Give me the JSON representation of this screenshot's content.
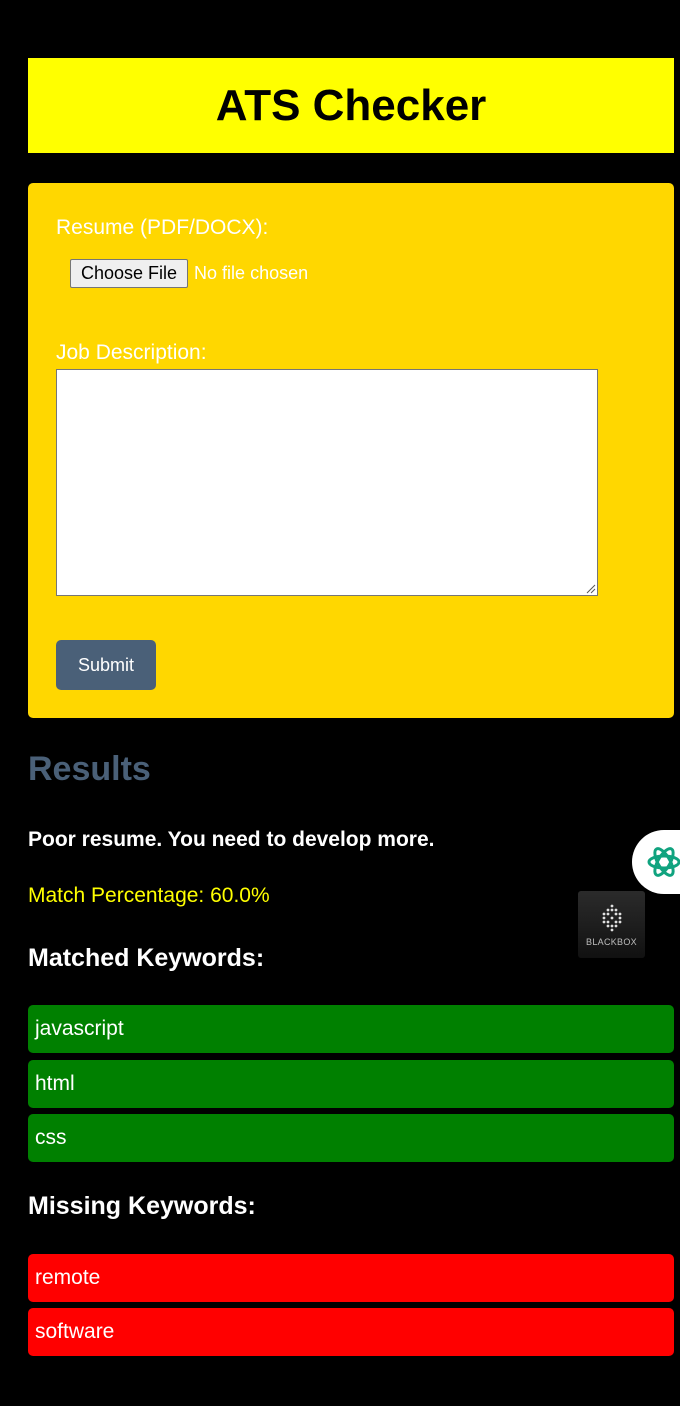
{
  "header": {
    "title": "ATS Checker"
  },
  "form": {
    "resume_label": "Resume (PDF/DOCX):",
    "file_button": "Choose File",
    "file_status": "No file chosen",
    "jd_label": "Job Description:",
    "jd_value": "",
    "submit_label": "Submit"
  },
  "results": {
    "heading": "Results",
    "verdict": "Poor resume. You need to develop more.",
    "match": "Match Percentage: 60.0%",
    "matched_heading": "Matched Keywords:",
    "matched": [
      "javascript",
      "html",
      "css"
    ],
    "missing_heading": "Missing Keywords:",
    "missing": [
      "remote",
      "software"
    ]
  },
  "overlays": {
    "badge_label": "BLACKBOX",
    "pill_icon": "openai-knot-icon",
    "badge_icon": "blackbox-logo-icon"
  },
  "colors": {
    "page_bg": "#000000",
    "header_bg": "#ffff00",
    "card_bg": "#ffd700",
    "accent": "#4a6078",
    "match_text": "#ffff00",
    "matched_bg": "#008000",
    "missing_bg": "#ff0000"
  }
}
